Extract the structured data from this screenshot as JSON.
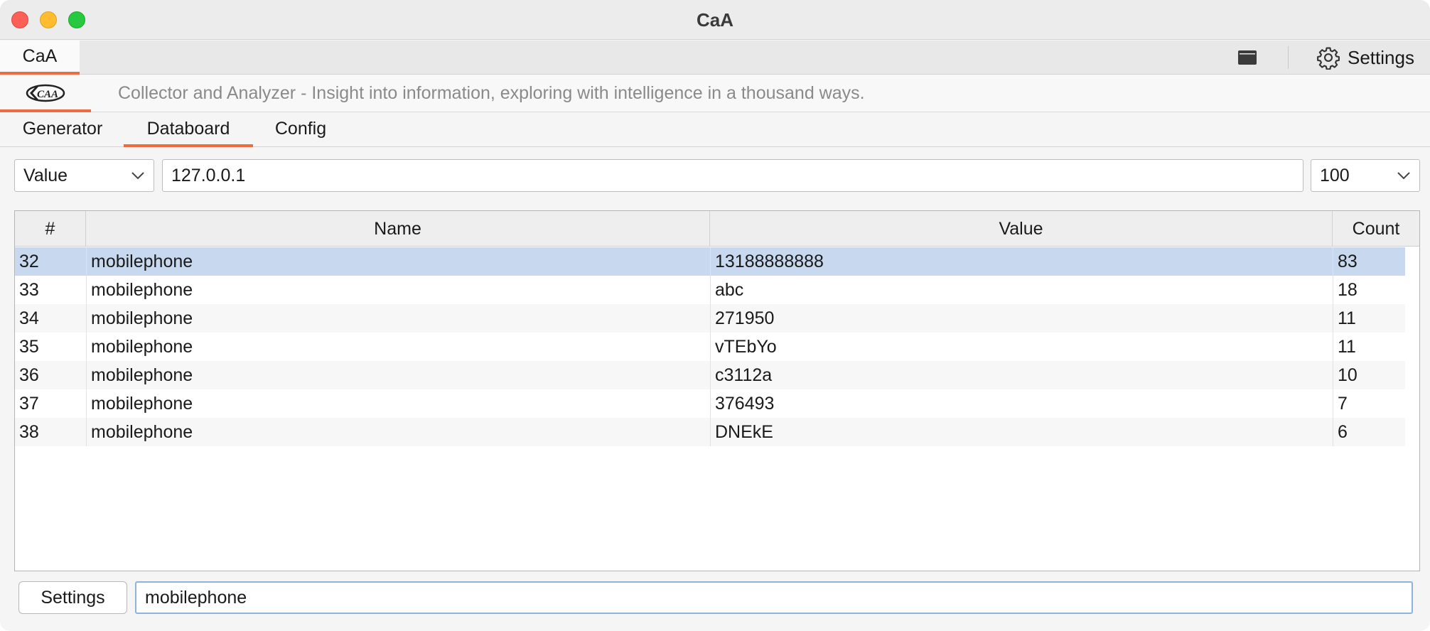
{
  "window": {
    "title": "CaA"
  },
  "top_tabs": [
    {
      "label": "CaA"
    }
  ],
  "toolbar": {
    "settings_label": "Settings"
  },
  "header": {
    "slogan": "Collector and Analyzer - Insight into information, exploring with intelligence in a thousand ways."
  },
  "sub_tabs": [
    {
      "label": "Generator",
      "active": false
    },
    {
      "label": "Databoard",
      "active": true
    },
    {
      "label": "Config",
      "active": false
    }
  ],
  "filter": {
    "field_select": "Value",
    "query": "127.0.0.1",
    "limit_select": "100"
  },
  "table": {
    "columns": [
      "#",
      "Name",
      "Value",
      "Count"
    ],
    "rows": [
      {
        "id": "32",
        "name": "mobilephone",
        "value": "13188888888",
        "count": "83",
        "selected": true
      },
      {
        "id": "33",
        "name": "mobilephone",
        "value": "abc",
        "count": "18"
      },
      {
        "id": "34",
        "name": "mobilephone",
        "value": "271950",
        "count": "11"
      },
      {
        "id": "35",
        "name": "mobilephone",
        "value": "vTEbYo",
        "count": "11"
      },
      {
        "id": "36",
        "name": "mobilephone",
        "value": "c3112a",
        "count": "10"
      },
      {
        "id": "37",
        "name": "mobilephone",
        "value": "376493",
        "count": "7"
      },
      {
        "id": "38",
        "name": "mobilephone",
        "value": "DNEkE",
        "count": "6"
      }
    ]
  },
  "bottom": {
    "settings_button": "Settings",
    "input_value": "mobilephone"
  },
  "colors": {
    "accent": "#ee6a3f",
    "selection": "#c8d8ee",
    "focus_border": "#8fb4dc"
  },
  "icons": {
    "layout": "layout-icon",
    "settings": "gear-icon",
    "logo": "caa-logo",
    "dropdown": "chevron-down-icon"
  }
}
